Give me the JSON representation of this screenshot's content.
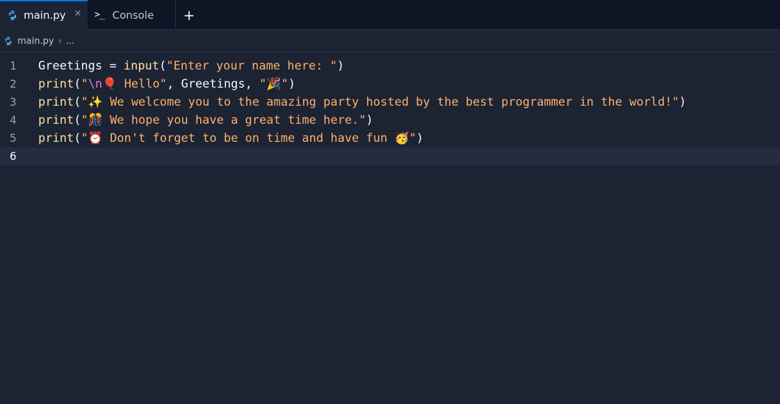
{
  "tabs": [
    {
      "label": "main.py",
      "close": "×",
      "active": true
    },
    {
      "label": "Console",
      "active": false
    },
    {
      "label": "+"
    }
  ],
  "breadcrumb": {
    "file": "main.py",
    "separator": "›",
    "more": "..."
  },
  "editor": {
    "current_line": 6,
    "lines": [
      {
        "number": "1"
      },
      {
        "number": "2"
      },
      {
        "number": "3"
      },
      {
        "number": "4"
      },
      {
        "number": "5"
      },
      {
        "number": "6"
      }
    ],
    "code": {
      "l1": {
        "ident": "Greetings",
        "op": " = ",
        "fn": "input",
        "open": "(",
        "str": "\"Enter your name here: \"",
        "close": ")"
      },
      "l2": {
        "fn": "print",
        "open": "(",
        "q1": "\"",
        "esc": "\\n",
        "str": "🎈 Hello\"",
        "mid": ", Greetings, ",
        "str2": "\"🎉\"",
        "close": ")"
      },
      "l3": {
        "fn": "print",
        "open": "(",
        "str": "\"✨ We welcome you to the amazing party hosted by the best programmer in the world!\"",
        "close": ")"
      },
      "l4": {
        "fn": "print",
        "open": "(",
        "str": "\"🎊 We hope you have a great time here.\"",
        "close": ")"
      },
      "l5": {
        "fn": "print",
        "open": "(",
        "str": "\"⏰ Don't forget to be on time and have fun 🥳\"",
        "close": ")"
      }
    }
  },
  "colors": {
    "background": "#1c2333",
    "tabbar": "#0e1525",
    "accent": "#0079f2",
    "function": "#ffe19c",
    "string": "#ffb26b",
    "escape": "#e47cd9"
  }
}
